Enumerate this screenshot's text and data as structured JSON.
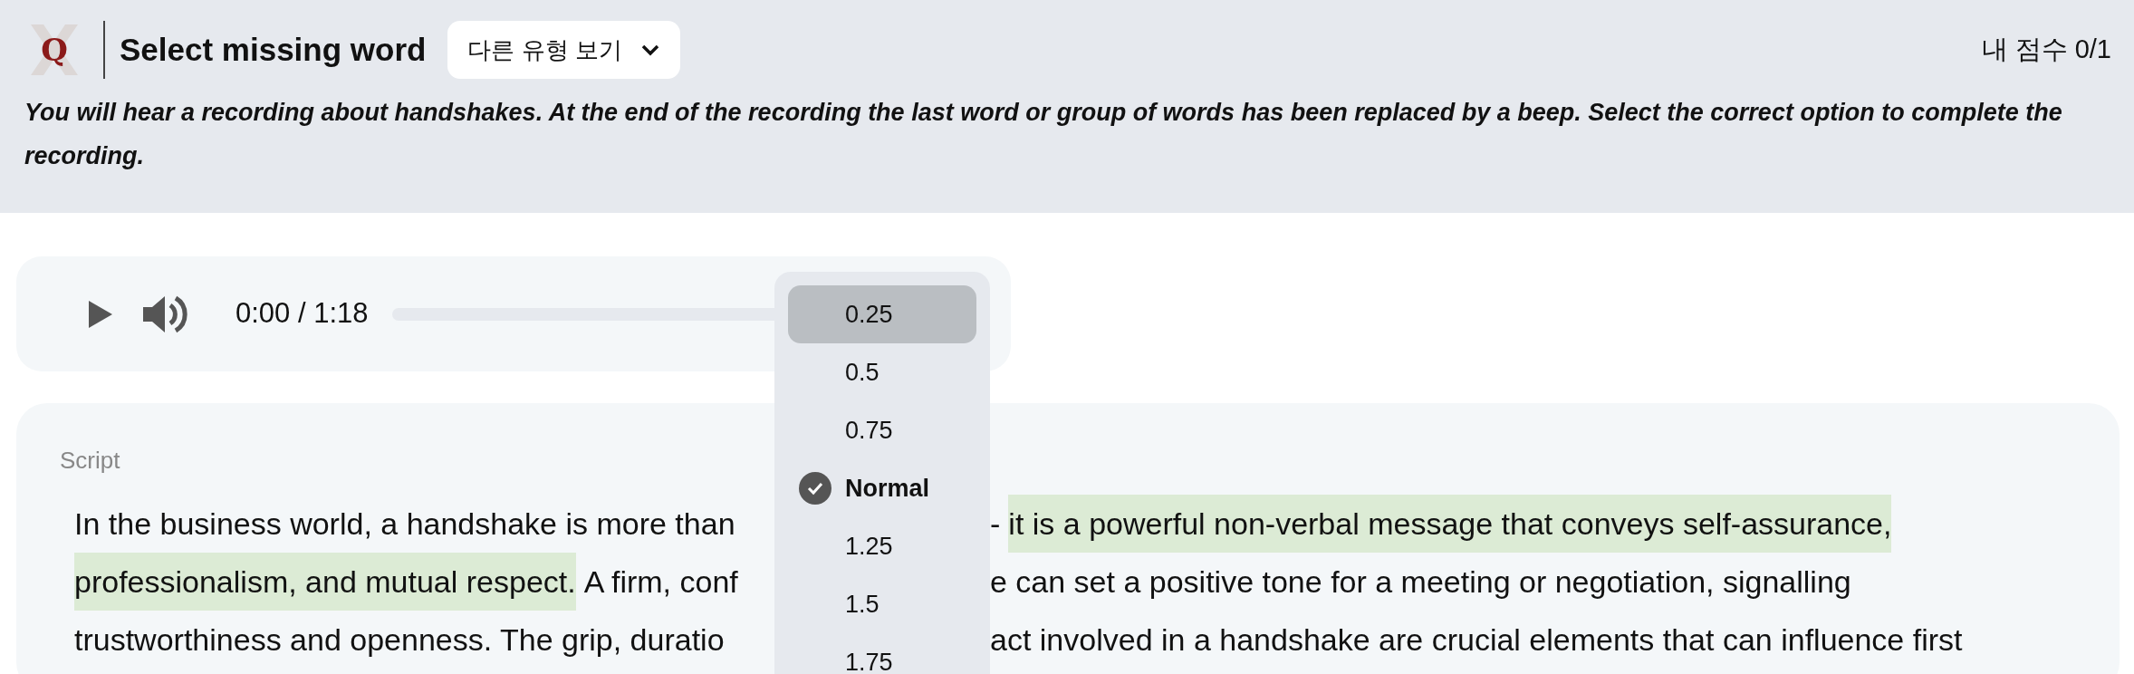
{
  "header": {
    "logo_letter": "Q",
    "title": "Select missing word",
    "type_button": "다른 유형 보기",
    "score": "내 점수 0/1"
  },
  "instruction": "You will hear a recording about handshakes. At the end of the recording the last word or group of words has been replaced by a beep. Select the correct option to complete the recording.",
  "player": {
    "time": "0:00 / 1:18"
  },
  "speed_menu": [
    {
      "label": "0.25",
      "selected": false,
      "hovered": true
    },
    {
      "label": "0.5",
      "selected": false,
      "hovered": false
    },
    {
      "label": "0.75",
      "selected": false,
      "hovered": false
    },
    {
      "label": "Normal",
      "selected": true,
      "hovered": false
    },
    {
      "label": "1.25",
      "selected": false,
      "hovered": false
    },
    {
      "label": "1.5",
      "selected": false,
      "hovered": false
    },
    {
      "label": "1.75",
      "selected": false,
      "hovered": false
    }
  ],
  "script": {
    "label": "Script",
    "lines": [
      {
        "left": [
          {
            "text": "In the business world, a handshake is more than",
            "highlighted": false
          }
        ],
        "right": [
          {
            "text": "-",
            "highlighted": false
          },
          {
            "text": "it is a powerful non-verbal message that conveys self-assurance,",
            "highlighted": true
          }
        ]
      },
      {
        "left": [
          {
            "text": "professionalism, and mutual respect.",
            "highlighted": true
          },
          {
            "text": "A firm, conf",
            "highlighted": false
          }
        ],
        "right": [
          {
            "text": "e can set a positive tone for a meeting or negotiation, signalling",
            "highlighted": false
          }
        ]
      },
      {
        "left": [
          {
            "text": "trustworthiness and openness. The grip, duratio",
            "highlighted": false
          }
        ],
        "right": [
          {
            "text": "act involved in a handshake are crucial elements that can influence first",
            "highlighted": false
          }
        ]
      }
    ]
  }
}
